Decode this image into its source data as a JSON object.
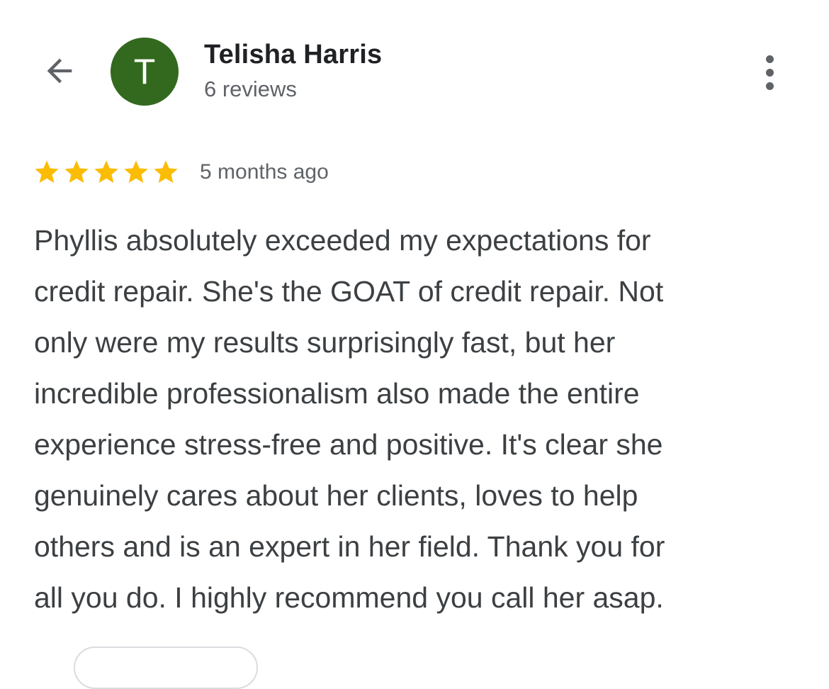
{
  "header": {
    "back_icon": "arrow-back-icon",
    "avatar_letter": "T",
    "avatar_color": "#33691e",
    "user_name": "Telisha Harris",
    "review_count": "6 reviews",
    "more_icon": "more-vertical-icon"
  },
  "review": {
    "rating": 5,
    "max_rating": 5,
    "star_color": "#fbbc04",
    "date": "5 months ago",
    "text": "Phyllis absolutely exceeded my expectations for\ncredit repair. She's the GOAT of credit repair. Not\nonly were my results surprisingly fast, but her\nincredible professionalism also made the entire\nexperience stress-free and positive. It's clear she\ngenuinely cares about her clients, loves to help\nothers and is an expert in her field. Thank you for\nall you do. I highly recommend you call her asap."
  }
}
